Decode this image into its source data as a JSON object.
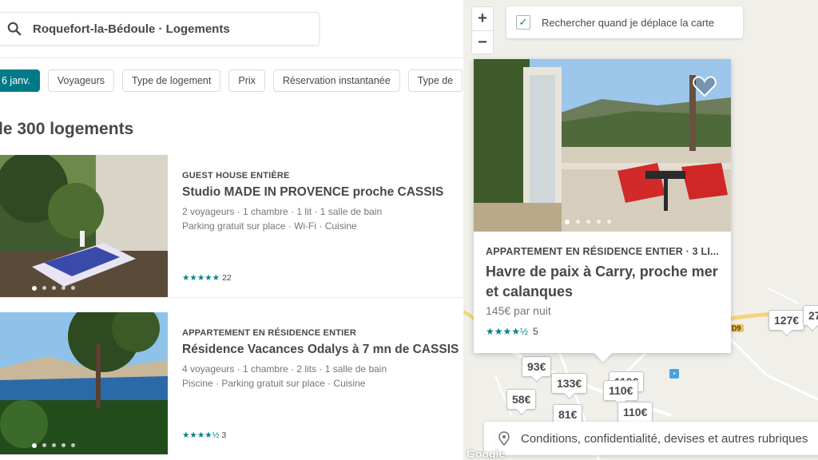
{
  "search": {
    "query": "Roquefort-la-Bédoule · Logements"
  },
  "filters": [
    {
      "label": "6 janv.",
      "active": true
    },
    {
      "label": "Voyageurs",
      "active": false
    },
    {
      "label": "Type de logement",
      "active": false
    },
    {
      "label": "Prix",
      "active": false
    },
    {
      "label": "Réservation instantanée",
      "active": false
    },
    {
      "label": "Type de",
      "active": false
    }
  ],
  "results": {
    "count_label": "le 300 logements"
  },
  "listings": [
    {
      "kind": "GUEST HOUSE ENTIÈRE",
      "title": "Studio MADE IN PROVENCE proche CASSIS",
      "details": "2 voyageurs · 1 chambre · 1 lit · 1 salle de bain",
      "amenities": "Parking gratuit sur place · Wi-Fi · Cuisine",
      "stars": "★★★★★",
      "reviews": "22",
      "rating": 5
    },
    {
      "kind": "APPARTEMENT EN RÉSIDENCE ENTIER",
      "title": "Résidence Vacances Odalys à 7 mn de CASSIS",
      "details": "4 voyageurs · 1 chambre · 2 lits · 1 salle de bain",
      "amenities": "Piscine · Parking gratuit sur place · Cuisine",
      "stars": "★★★★½",
      "reviews": "3",
      "rating": 4.5
    }
  ],
  "map": {
    "zoom_in": "+",
    "zoom_out": "−",
    "search_when_moving": "Rechercher quand je déplace la carte",
    "search_when_moving_checked": true,
    "card": {
      "kind": "APPARTEMENT EN RÉSIDENCE ENTIER · 3 LI...",
      "title": "Havre de paix à Carry, proche mer et calanques",
      "price": "145€ par nuit",
      "stars": "★★★★½",
      "reviews": "5"
    },
    "pins": [
      "127€",
      "27",
      "93€",
      "133€",
      "110€",
      "58€",
      "110€",
      "81€",
      "110€"
    ],
    "road_label": "D9",
    "footer": "Conditions, confidentialité, devises et autres rubriques",
    "google": "Google"
  },
  "colors": {
    "accent": "#007a87",
    "stars": "#008489",
    "text": "#484848"
  }
}
